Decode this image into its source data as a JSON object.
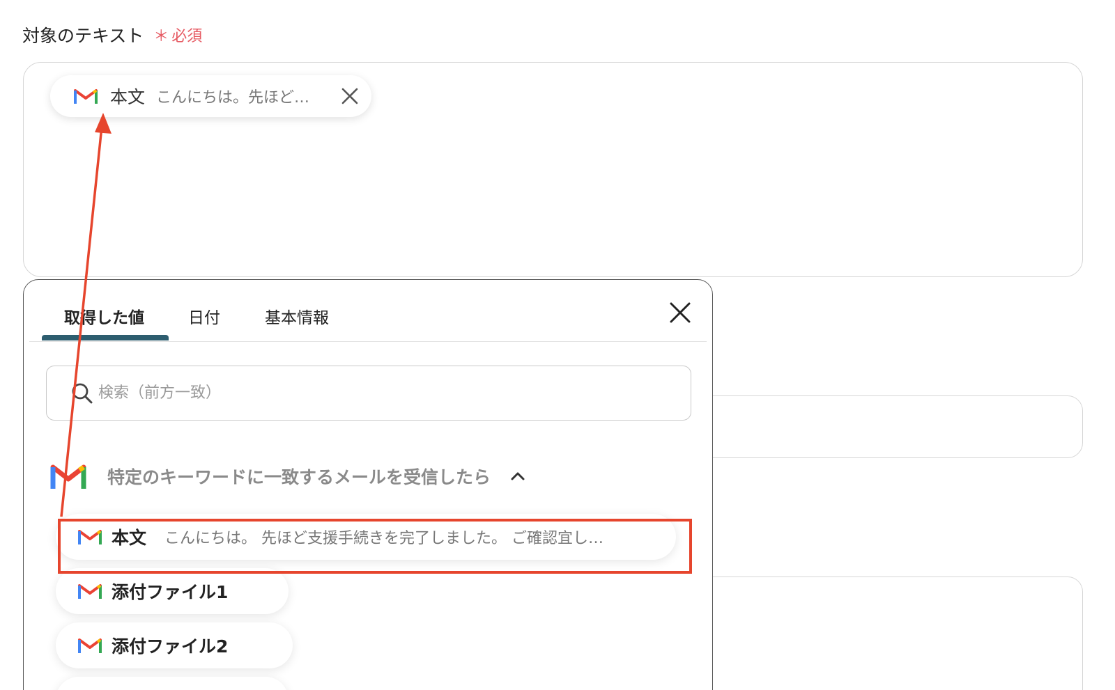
{
  "form": {
    "label": "対象のテキスト",
    "required_mark": "＊",
    "required_text": "必須"
  },
  "chip": {
    "name": "本文",
    "preview": "こんにちは。先ほど…",
    "icon": "gmail-icon",
    "close_icon": "close-icon"
  },
  "panel": {
    "tabs": [
      {
        "label": "取得した値",
        "active": true
      },
      {
        "label": "日付",
        "active": false
      },
      {
        "label": "基本情報",
        "active": false
      }
    ],
    "close_icon": "close-icon",
    "search": {
      "placeholder": "検索（前方一致）",
      "value": "",
      "icon": "search-icon"
    },
    "group": {
      "title": "特定のキーワードに一致するメールを受信したら",
      "icon": "gmail-icon",
      "expanded": true
    },
    "items": [
      {
        "name": "本文",
        "preview": "こんにちは。 先ほど支援手続きを完了しました。 ご確認宜し…",
        "highlighted": true
      },
      {
        "name": "添付ファイル1",
        "preview": ""
      },
      {
        "name": "添付ファイル2",
        "preview": ""
      },
      {
        "name": "",
        "preview": ""
      }
    ]
  },
  "annotation": {
    "highlight_color": "#e6452d",
    "arrow_color": "#e6452d"
  },
  "colors": {
    "required": "#e65a63",
    "tab_underline": "#2d5d6f",
    "gmail_red": "#ea4335",
    "gmail_blue": "#4285f4",
    "gmail_green": "#34a853",
    "gmail_yellow": "#fbbc04"
  }
}
